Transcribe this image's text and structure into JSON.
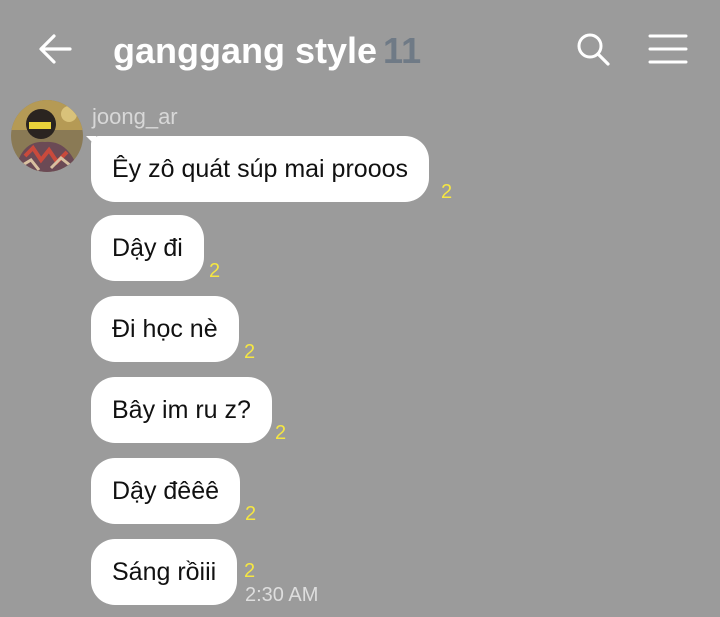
{
  "header": {
    "title": "ganggang style",
    "member_count": "11",
    "icons": {
      "back": "back-arrow-icon",
      "search": "search-icon",
      "menu": "menu-icon"
    }
  },
  "colors": {
    "background": "#9b9b9b",
    "bubble": "#ffffff",
    "unread_count": "#f5e642",
    "member_count": "#6f7a86"
  },
  "message_group": {
    "sender": "joong_ar",
    "time": "2:30 AM",
    "messages": [
      {
        "text": "Êy zô quát súp mai prooos",
        "unread": "2"
      },
      {
        "text": "Dậy đi",
        "unread": "2"
      },
      {
        "text": "Đi học nè",
        "unread": "2"
      },
      {
        "text": "Bây im ru z?",
        "unread": "2"
      },
      {
        "text": "Dậy đêêê",
        "unread": "2"
      },
      {
        "text": "Sáng rồiii",
        "unread": "2"
      }
    ]
  }
}
